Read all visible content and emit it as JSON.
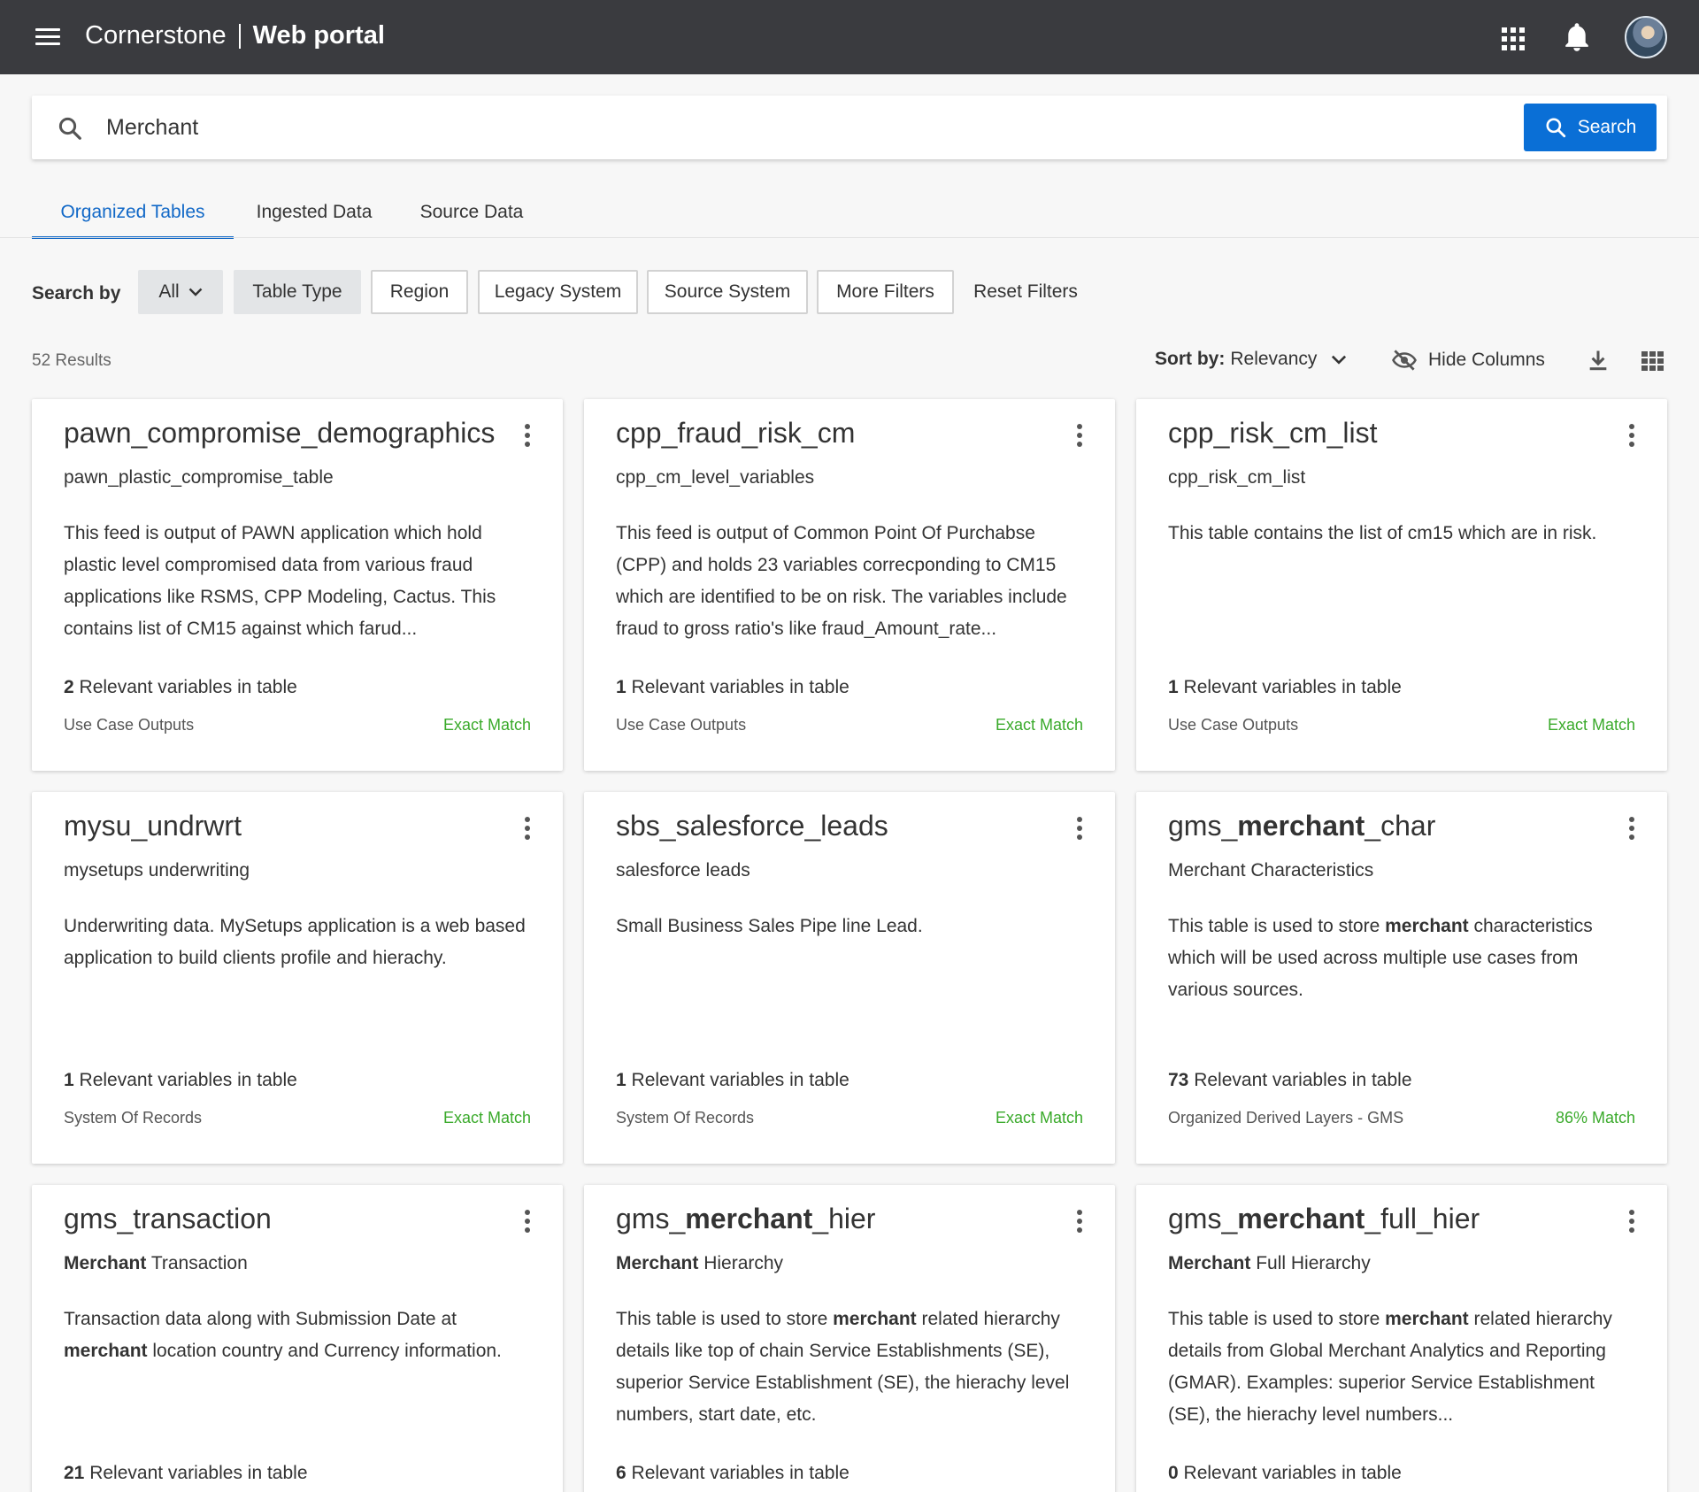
{
  "app": {
    "brand": "Cornerstone",
    "product": "Web portal"
  },
  "search": {
    "value": "Merchant",
    "button_label": "Search"
  },
  "tabs": [
    {
      "label": "Organized Tables",
      "active": true
    },
    {
      "label": "Ingested Data",
      "active": false
    },
    {
      "label": "Source Data",
      "active": false
    }
  ],
  "filters": {
    "search_by_label": "Search by",
    "all_label": "All",
    "table_type": "Table Type",
    "region": "Region",
    "legacy_system": "Legacy System",
    "source_system": "Source System",
    "more_filters": "More Filters",
    "reset_filters": "Reset Filters"
  },
  "results": {
    "count": "52 Results",
    "sort_label": "Sort by:",
    "sort_value": "Relevancy",
    "hide_columns": "Hide Columns"
  },
  "cards": [
    {
      "title": "pawn_compromise_demographics",
      "subtitle": "pawn_plastic_compromise_table",
      "description": "This feed is output of PAWN application which hold plastic level compromised data from various fraud applications like RSMS, CPP Modeling, Cactus. This contains list of CM15 against which farud...",
      "var_count": "2",
      "var_label": " Relevant variables in table",
      "type": "Use Case Outputs",
      "match": "Exact Match"
    },
    {
      "title": "cpp_fraud_risk_cm",
      "subtitle": "cpp_cm_level_variables",
      "description": "This feed is output of Common Point Of Purchabse (CPP) and holds 23 variables correcponding to CM15 which are identified to be on risk. The variables include fraud to gross ratio's like fraud_Amount_rate...",
      "var_count": "1",
      "var_label": " Relevant variables in table",
      "type": "Use Case Outputs",
      "match": "Exact Match"
    },
    {
      "title": "cpp_risk_cm_list",
      "subtitle": "cpp_risk_cm_list",
      "description": "This table contains the list of cm15 which are in risk.",
      "var_count": "1",
      "var_label": " Relevant variables in table",
      "type": "Use Case Outputs",
      "match": "Exact Match"
    },
    {
      "title": "mysu_undrwrt",
      "subtitle": "mysetups underwriting",
      "description": "Underwriting data. MySetups application is a web based application to build clients profile and hierachy.",
      "var_count": "1",
      "var_label": " Relevant variables in table",
      "type": "System Of Records",
      "match": "Exact Match"
    },
    {
      "title": "sbs_salesforce_leads",
      "subtitle": "salesforce leads",
      "description": "Small Business Sales Pipe line Lead.",
      "var_count": "1",
      "var_label": " Relevant variables in table",
      "type": "System Of Records",
      "match": "Exact Match"
    },
    {
      "title_pre": "gms_",
      "title_bold": "merchant",
      "title_post": "_char",
      "subtitle": "Merchant Characteristics",
      "desc_pre": "This table is used to store ",
      "desc_bold": "merchant",
      "desc_post": " characteristics which will be used across multiple use cases from various sources.",
      "var_count": "73",
      "var_label": " Relevant variables in table",
      "type": "Organized Derived Layers - GMS",
      "match": "86% Match"
    },
    {
      "title": "gms_transaction",
      "sub_bold": "Merchant",
      "sub_post": " Transaction",
      "desc_pre": "Transaction data along with Submission Date at ",
      "desc_bold": "merchant",
      "desc_post": " location country and Currency information.",
      "var_count": "21",
      "var_label": " Relevant variables in table"
    },
    {
      "title_pre": "gms_",
      "title_bold": "merchant",
      "title_post": "_hier",
      "sub_bold": "Merchant",
      "sub_post": " Hierarchy",
      "desc_pre": "This table is used to store ",
      "desc_bold": "merchant",
      "desc_post": " related hierarchy details like top of chain Service Establishments (SE), superior Service Establishment (SE), the hierachy level numbers, start date, etc.",
      "var_count": "6",
      "var_label": " Relevant variables in table"
    },
    {
      "title_pre": "gms_",
      "title_bold": "merchant",
      "title_post": "_full_hier",
      "sub_bold": "Merchant",
      "sub_post": " Full Hierarchy",
      "desc_pre": "This table is used to store ",
      "desc_bold": "merchant",
      "desc_post": " related hierarchy details from Global Merchant Analytics and Reporting (GMAR). Examples: superior Service Establishment (SE), the hierachy level numbers...",
      "var_count": "0",
      "var_label": " Relevant variables in table"
    }
  ],
  "colors": {
    "topbar": "#3a3b3f",
    "primary": "#0a6fd6",
    "match": "#3aaa2b",
    "active_tab": "#1168c7"
  },
  "icons": [
    "menu-icon",
    "apps-grid-icon",
    "bell-icon",
    "avatar",
    "search-icon",
    "chevron-down-icon",
    "eye-off-icon",
    "download-icon",
    "grid-view-icon",
    "more-vert-icon"
  ]
}
